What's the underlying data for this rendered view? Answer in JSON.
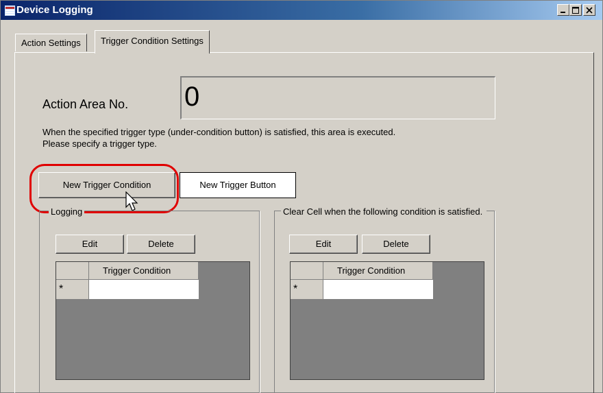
{
  "window": {
    "title": "Device Logging"
  },
  "tabs": [
    {
      "label": "Action Settings"
    },
    {
      "label": "Trigger Condition Settings"
    }
  ],
  "action_area": {
    "label": "Action Area No.",
    "value": "0"
  },
  "description": {
    "line1": "When the specified trigger type (under-condition button) is satisfied, this area is executed.",
    "line2": "Please specify a trigger type."
  },
  "buttons": {
    "new_trigger_condition": "New Trigger Condition",
    "new_trigger_button": "New Trigger Button"
  },
  "logging_group": {
    "title": "Logging",
    "edit": "Edit",
    "delete": "Delete",
    "column": "Trigger Condition",
    "row_marker": "*"
  },
  "clear_group": {
    "title": "Clear Cell when the following condition is satisfied.",
    "edit": "Edit",
    "delete": "Delete",
    "column": "Trigger Condition",
    "row_marker": "*"
  },
  "colors": {
    "highlight": "#e00000",
    "title_bar": "#0a246a",
    "face": "#d4d0c8"
  }
}
